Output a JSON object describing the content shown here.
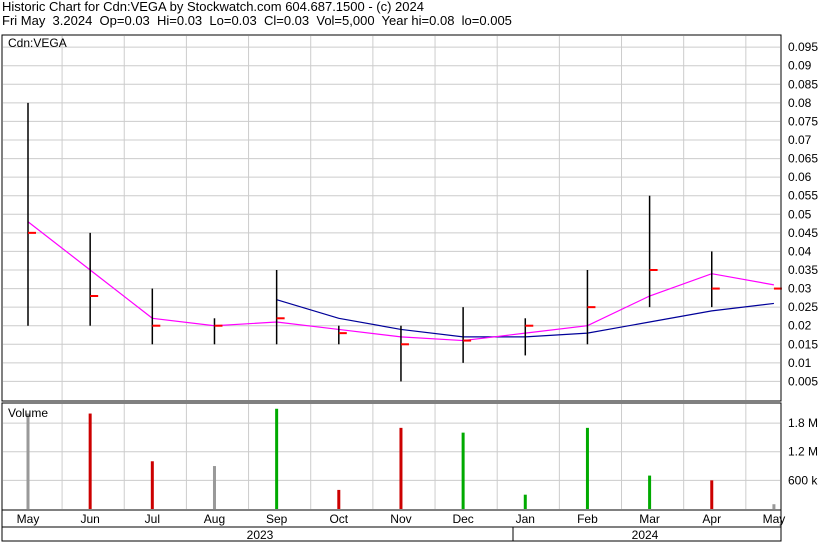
{
  "header": {
    "line1": "Historic Chart for Cdn:VEGA by Stockwatch.com 604.687.1500 - (c) 2024",
    "line2": "Fri May  3.2024  Op=0.03  Hi=0.03  Lo=0.03  Cl=0.03  Vol=5,000  Year hi=0.08  lo=0.005"
  },
  "colors": {
    "price_bar": "#000000",
    "close_tick": "#ff0000",
    "ma_short": "#ff00ff",
    "ma_long": "#000099",
    "vol_up": "#00aa00",
    "vol_down": "#cc0000",
    "vol_flat": "#999999",
    "grid": "#cccccc"
  },
  "chart_data": [
    {
      "type": "line",
      "title": "Cdn:VEGA",
      "y_ticks": [
        "0.095",
        "0.09",
        "0.085",
        "0.08",
        "0.075",
        "0.07",
        "0.065",
        "0.06",
        "0.055",
        "0.05",
        "0.045",
        "0.04",
        "0.035",
        "0.03",
        "0.025",
        "0.02",
        "0.015",
        "0.01",
        "0.005"
      ],
      "ylim": [
        0.0,
        0.098
      ],
      "grid": true,
      "x_month_labels": [
        "May",
        "Jun",
        "Jul",
        "Aug",
        "Sep",
        "Oct",
        "Nov",
        "Dec",
        "Jan",
        "Feb",
        "Mar",
        "Apr",
        "May"
      ],
      "x_year_labels": [
        "2023",
        "2024"
      ],
      "series": [
        {
          "style": "ohlc",
          "months": [
            "May 2023",
            "Jun 2023",
            "Jul 2023",
            "Aug 2023",
            "Sep 2023",
            "Oct 2023",
            "Nov 2023",
            "Dec 2023",
            "Jan 2024",
            "Feb 2024",
            "Mar 2024",
            "Apr 2024",
            "May 2024"
          ],
          "close": [
            0.045,
            0.028,
            0.02,
            0.02,
            0.022,
            0.018,
            0.015,
            0.016,
            0.02,
            0.025,
            0.035,
            0.03,
            0.03
          ],
          "high": [
            0.08,
            0.045,
            0.03,
            0.022,
            0.035,
            0.02,
            0.02,
            0.025,
            0.022,
            0.035,
            0.055,
            0.04,
            0.03
          ],
          "low": [
            0.02,
            0.02,
            0.015,
            0.015,
            0.015,
            0.015,
            0.005,
            0.01,
            0.012,
            0.015,
            0.025,
            0.025,
            0.03
          ]
        },
        {
          "style": "moving_average_short",
          "values": [
            0.048,
            0.035,
            0.022,
            0.02,
            0.021,
            0.019,
            0.017,
            0.016,
            0.018,
            0.02,
            0.028,
            0.034,
            0.031
          ]
        },
        {
          "style": "moving_average_long",
          "values": [
            null,
            null,
            null,
            null,
            0.027,
            0.022,
            0.019,
            0.017,
            0.017,
            0.018,
            0.021,
            0.024,
            0.026
          ]
        }
      ]
    },
    {
      "type": "bar",
      "title": "Volume",
      "y_ticks": [
        "1.8 M",
        "1.2 M",
        "600 k"
      ],
      "ylim": [
        0,
        2200000
      ],
      "months": [
        "May 2023",
        "Jun 2023",
        "Jul 2023",
        "Aug 2023",
        "Sep 2023",
        "Oct 2023",
        "Nov 2023",
        "Dec 2023",
        "Jan 2024",
        "Feb 2024",
        "Mar 2024",
        "Apr 2024",
        "May 2024"
      ],
      "peak_volume": [
        2000000,
        2000000,
        1000000,
        900000,
        2100000,
        400000,
        1700000,
        1600000,
        300000,
        1700000,
        700000,
        600000,
        100000
      ]
    }
  ]
}
